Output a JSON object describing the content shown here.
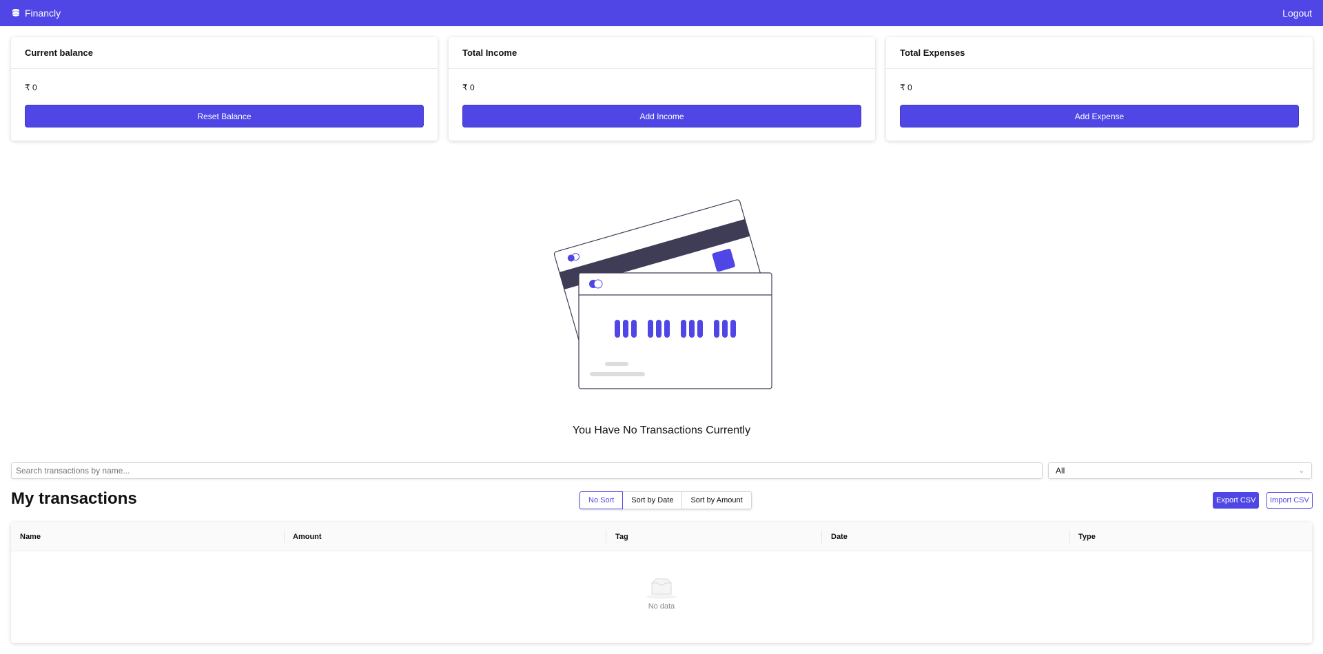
{
  "navbar": {
    "brand": "Financly",
    "logout": "Logout"
  },
  "cards": [
    {
      "title": "Current balance",
      "value": "₹ 0",
      "button": "Reset Balance"
    },
    {
      "title": "Total Income",
      "value": "₹ 0",
      "button": "Add Income"
    },
    {
      "title": "Total Expenses",
      "value": "₹ 0",
      "button": "Add Expense"
    }
  ],
  "empty": {
    "message": "You Have No Transactions Currently"
  },
  "filters": {
    "search_placeholder": "Search transactions by name...",
    "type_selected": "All"
  },
  "transactions": {
    "title": "My transactions",
    "sort": [
      "No Sort",
      "Sort by Date",
      "Sort by Amount"
    ],
    "export": "Export CSV",
    "import": "Import CSV",
    "columns": [
      "Name",
      "Amount",
      "Tag",
      "Date",
      "Type"
    ],
    "empty_text": "No data"
  },
  "colors": {
    "accent": "#4f46e5",
    "dark_stripe": "#3f3d56"
  }
}
